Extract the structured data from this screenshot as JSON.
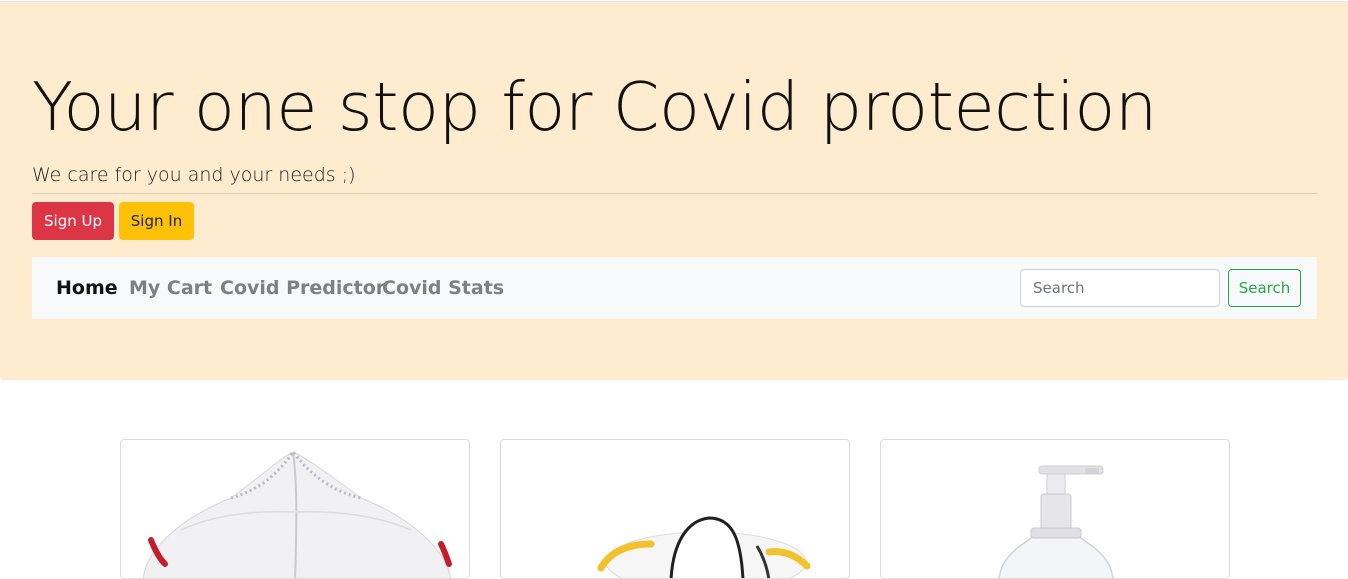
{
  "hero": {
    "title": "Your one stop for Covid protection",
    "subtitle": "We care for you and your needs ;)"
  },
  "auth": {
    "signup_label": "Sign Up",
    "signin_label": "Sign In"
  },
  "nav": {
    "items": [
      {
        "label": "Home",
        "active": true
      },
      {
        "label": "My Cart",
        "active": false
      },
      {
        "label": "Covid Predictor",
        "active": false
      },
      {
        "label": "Covid Stats",
        "active": false
      }
    ]
  },
  "search": {
    "placeholder": "Search",
    "value": "",
    "button_label": "Search"
  },
  "products": [
    {
      "image": "face-mask"
    },
    {
      "image": "face-shield"
    },
    {
      "image": "sanitizer-bottle"
    }
  ],
  "colors": {
    "hero_background": "#ffebcd",
    "signup": "#dc3545",
    "signin": "#ffc107",
    "search_button": "#28a745",
    "navbar": "#f8f9fa"
  }
}
